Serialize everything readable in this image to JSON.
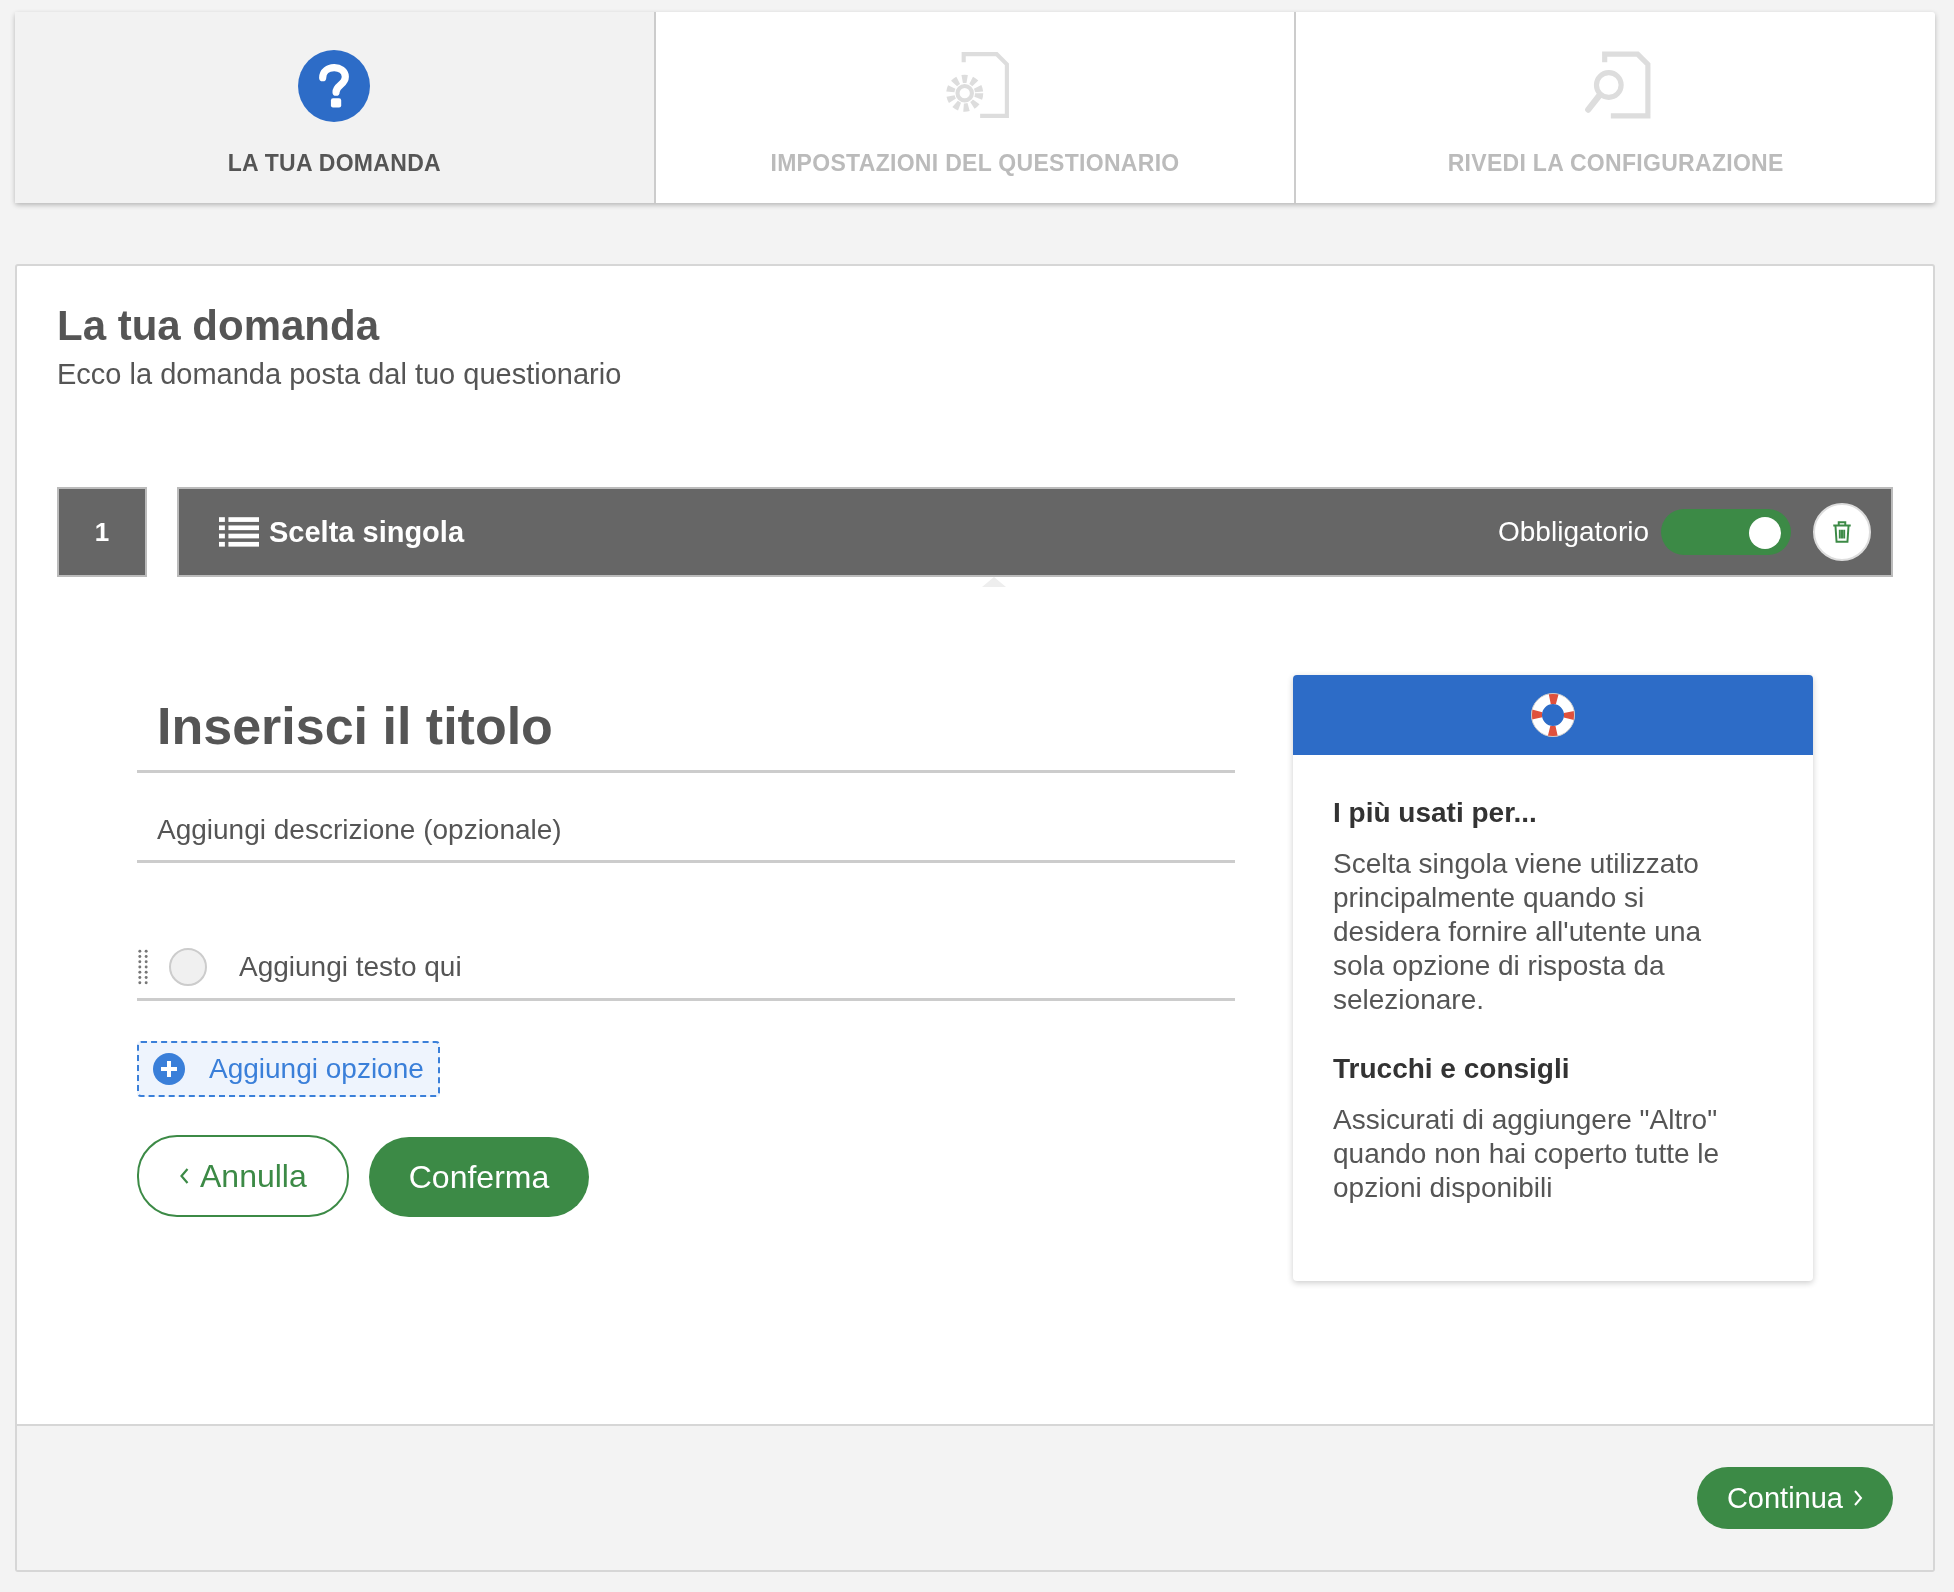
{
  "steps": [
    {
      "label": "LA TUA DOMANDA",
      "kind": "question",
      "selected": true
    },
    {
      "label": "IMPOSTAZIONI DEL QUESTIONARIO",
      "kind": "settings",
      "selected": false
    },
    {
      "label": "RIVEDI LA CONFIGURAZIONE",
      "kind": "review",
      "selected": false
    }
  ],
  "page": {
    "title": "La tua domanda",
    "subtitle": "Ecco la domanda posta dal tuo questionario"
  },
  "question": {
    "number": "1",
    "type_label": "Scelta singola",
    "required_label": "Obbligatorio",
    "required": true
  },
  "editor": {
    "title_placeholder": "Inserisci il titolo",
    "description_placeholder": "Aggiungi descrizione (opzionale)",
    "options": [
      {
        "placeholder": "Aggiungi testo qui",
        "selected": false
      }
    ],
    "add_option": "Aggiungi opzione",
    "cancel": "Annulla",
    "confirm": "Conferma"
  },
  "help": {
    "sections": [
      {
        "heading": "I più usati per...",
        "text": "Scelta singola viene utilizzato principalmente quando si desidera fornire all'utente una sola opzione di risposta da selezionare."
      },
      {
        "heading": "Trucchi e consigli",
        "text": "Assicurati di aggiungere \"Altro\" quando non hai coperto tutte le opzioni disponibili"
      }
    ]
  },
  "footer": {
    "continue": "Continua"
  }
}
